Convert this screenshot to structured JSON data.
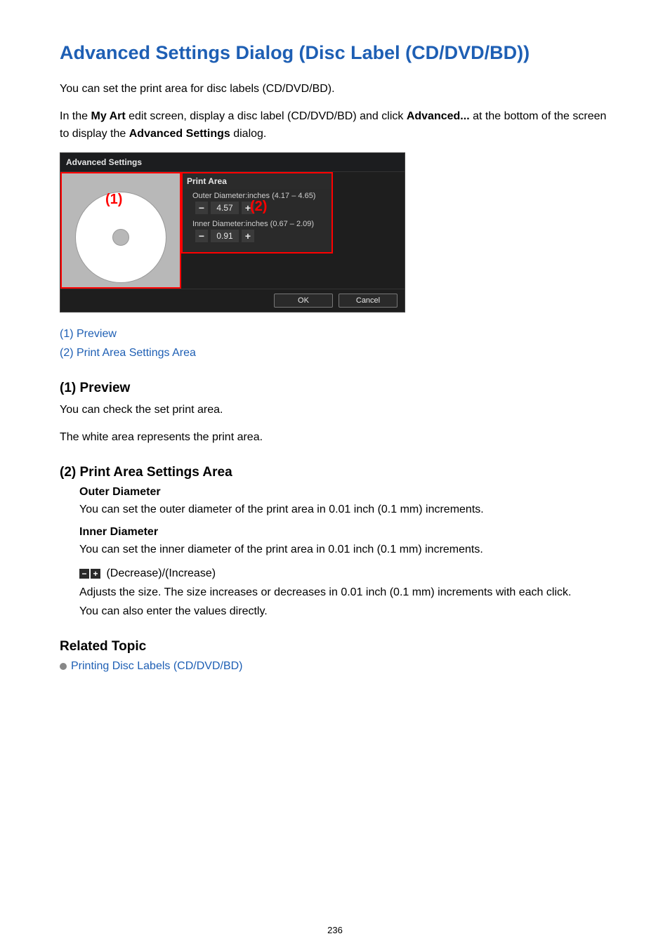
{
  "title": "Advanced Settings Dialog (Disc Label (CD/DVD/BD))",
  "intro": {
    "line1": "You can set the print area for disc labels (CD/DVD/BD).",
    "line2a": "In the ",
    "line2b": "My Art",
    "line2c": " edit screen, display a disc label (CD/DVD/BD) and click ",
    "line2d": "Advanced...",
    "line2e": " at the bottom of the screen to display the ",
    "line2f": "Advanced Settings",
    "line2g": " dialog."
  },
  "figure": {
    "window_title": "Advanced Settings",
    "callout1": "(1)",
    "callout2": "(2)",
    "print_area_header": "Print Area",
    "outer_label": "Outer Diameter:inches (4.17 – 4.65)",
    "outer_value": "4.57",
    "inner_label": "Inner Diameter:inches (0.67 – 2.09)",
    "inner_value": "0.91",
    "minus": "−",
    "plus": "+",
    "ok": "OK",
    "cancel": "Cancel"
  },
  "links": {
    "preview": "(1) Preview",
    "print_area": "(2) Print Area Settings Area"
  },
  "section1": {
    "heading": "(1) Preview",
    "p1": "You can check the set print area.",
    "p2": "The white area represents the print area."
  },
  "section2": {
    "heading": "(2) Print Area Settings Area",
    "outer_dt": "Outer Diameter",
    "outer_dd": "You can set the outer diameter of the print area in 0.01 inch (0.1 mm) increments.",
    "inner_dt": "Inner Diameter",
    "inner_dd": "You can set the inner diameter of the print area in 0.01 inch (0.1 mm) increments.",
    "pm_label": " (Decrease)/(Increase)",
    "pm_desc1": "Adjusts the size. The size increases or decreases in 0.01 inch (0.1 mm) increments with each click.",
    "pm_desc2": "You can also enter the values directly."
  },
  "related": {
    "heading": "Related Topic",
    "link1": "Printing Disc Labels (CD/DVD/BD)"
  },
  "page_number": "236"
}
